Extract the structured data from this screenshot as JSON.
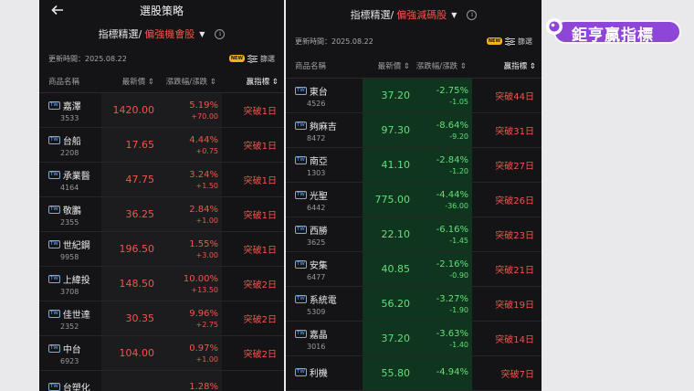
{
  "left": {
    "title": "選股策略",
    "selector": {
      "prefix": "指標精選/",
      "strategy": "偏強機會股"
    },
    "update_label": "更新時間：",
    "update_date": "2025.08.22",
    "new_badge": "NEW",
    "filter_label": "篩選",
    "columns": {
      "name": "商品名稱",
      "price": "最新價",
      "change": "漲跌幅/漲跌",
      "signal": "贏指標"
    },
    "rows": [
      {
        "name": "嘉澤",
        "code": "3533",
        "price": "1420.00",
        "pct": "5.19%",
        "delta": "+70.00",
        "signal": "突破1日"
      },
      {
        "name": "台船",
        "code": "2208",
        "price": "17.65",
        "pct": "4.44%",
        "delta": "+0.75",
        "signal": "突破1日"
      },
      {
        "name": "承業醫",
        "code": "4164",
        "price": "47.75",
        "pct": "3.24%",
        "delta": "+1.50",
        "signal": "突破1日"
      },
      {
        "name": "敬鵬",
        "code": "2355",
        "price": "36.25",
        "pct": "2.84%",
        "delta": "+1.00",
        "signal": "突破1日"
      },
      {
        "name": "世紀鋼",
        "code": "9958",
        "price": "196.50",
        "pct": "1.55%",
        "delta": "+3.00",
        "signal": "突破1日"
      },
      {
        "name": "上緯投",
        "code": "3708",
        "price": "148.50",
        "pct": "10.00%",
        "delta": "+13.50",
        "signal": "突破2日"
      },
      {
        "name": "佳世達",
        "code": "2352",
        "price": "30.35",
        "pct": "9.96%",
        "delta": "+2.75",
        "signal": "突破2日"
      },
      {
        "name": "中台",
        "code": "6923",
        "price": "104.00",
        "pct": "0.97%",
        "delta": "+1.00",
        "signal": "突破2日"
      },
      {
        "name": "台塑化",
        "code": "",
        "price": "",
        "pct": "1.28%",
        "delta": "",
        "signal": ""
      }
    ]
  },
  "right": {
    "selector": {
      "prefix": "指標精選/",
      "strategy": "偏強減碼股"
    },
    "update_label": "更新時間：",
    "update_date": "2025.08.22",
    "new_badge": "NEW",
    "filter_label": "篩選",
    "columns": {
      "name": "商品名稱",
      "price": "最新價",
      "change": "漲跌幅/漲跌",
      "signal": "贏指標"
    },
    "rows": [
      {
        "name": "東台",
        "code": "4526",
        "price": "37.20",
        "pct": "-2.75%",
        "delta": "-1.05",
        "signal": "突破44日"
      },
      {
        "name": "夠麻吉",
        "code": "8472",
        "price": "97.30",
        "pct": "-8.64%",
        "delta": "-9.20",
        "signal": "突破31日"
      },
      {
        "name": "南亞",
        "code": "1303",
        "price": "41.10",
        "pct": "-2.84%",
        "delta": "-1.20",
        "signal": "突破27日"
      },
      {
        "name": "光聖",
        "code": "6442",
        "price": "775.00",
        "pct": "-4.44%",
        "delta": "-36.00",
        "signal": "突破26日"
      },
      {
        "name": "西勝",
        "code": "3625",
        "price": "22.10",
        "pct": "-6.16%",
        "delta": "-1.45",
        "signal": "突破23日"
      },
      {
        "name": "安集",
        "code": "6477",
        "price": "40.85",
        "pct": "-2.16%",
        "delta": "-0.90",
        "signal": "突破21日"
      },
      {
        "name": "系統電",
        "code": "5309",
        "price": "56.20",
        "pct": "-3.27%",
        "delta": "-1.90",
        "signal": "突破19日"
      },
      {
        "name": "嘉晶",
        "code": "3016",
        "price": "37.20",
        "pct": "-3.63%",
        "delta": "-1.40",
        "signal": "突破14日"
      },
      {
        "name": "利機",
        "code": "",
        "price": "55.80",
        "pct": "-4.94%",
        "delta": "",
        "signal": "突破7日"
      }
    ]
  },
  "tw_badge": "TW",
  "colors": {
    "up": "#f2554c",
    "down": "#5fe07a",
    "brand": "#8e46d8"
  },
  "logo": {
    "text": "鉅亨贏指標"
  }
}
